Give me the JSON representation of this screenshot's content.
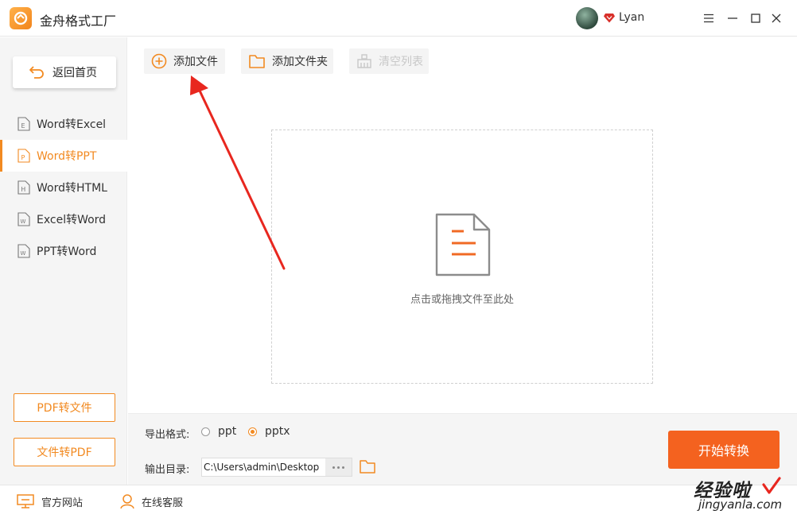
{
  "app": {
    "title": "金舟格式工厂",
    "user": "Lyan"
  },
  "sidebar": {
    "home_label": "返回首页",
    "items": [
      {
        "label": "Word转Excel",
        "icon_letter": "E",
        "active": false
      },
      {
        "label": "Word转PPT",
        "icon_letter": "P",
        "active": true
      },
      {
        "label": "Word转HTML",
        "icon_letter": "H",
        "active": false
      },
      {
        "label": "Excel转Word",
        "icon_letter": "W",
        "active": false
      },
      {
        "label": "PPT转Word",
        "icon_letter": "W",
        "active": false
      }
    ],
    "pdf_to_file": "PDF转文件",
    "file_to_pdf": "文件转PDF"
  },
  "toolbar": {
    "add_file": "添加文件",
    "add_folder": "添加文件夹",
    "clear_list": "清空列表"
  },
  "dropzone": {
    "hint": "点击或拖拽文件至此处"
  },
  "export": {
    "format_label": "导出格式:",
    "options": [
      "ppt",
      "pptx"
    ],
    "selected": "pptx",
    "dir_label": "输出目录:",
    "dir_value": "C:\\Users\\admin\\Desktop",
    "start_label": "开始转换"
  },
  "footer": {
    "website": "官方网站",
    "support": "在线客服"
  },
  "watermark": {
    "line1": "经验啦",
    "line2": "jingyanla.com"
  },
  "colors": {
    "accent": "#f28a21",
    "start_button": "#f4621f",
    "annotation_arrow": "#e8271f"
  }
}
